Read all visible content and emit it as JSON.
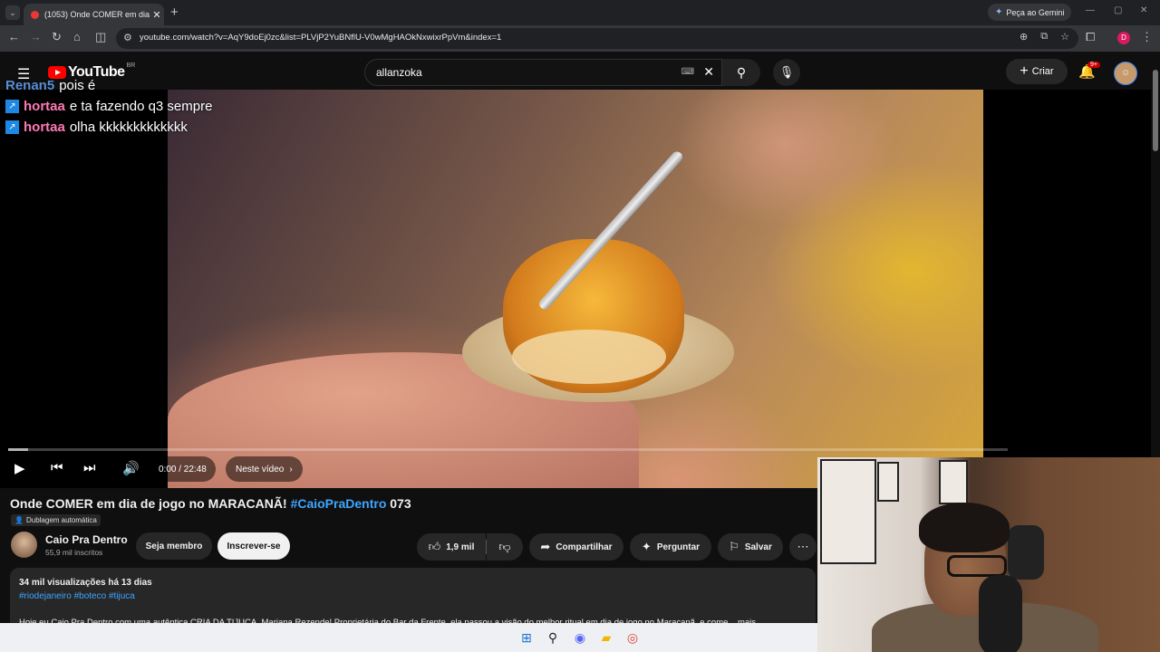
{
  "browser": {
    "tab_title": "(1053) Onde COMER em dia de",
    "new_tab_icon": "plus-icon",
    "gemini_label": "Peça ao Gemini",
    "url": "youtube.com/watch?v=AqY9doEj0zc&list=PLVjP2YuBNflU-V0wMgHAOkNxwixrPpVm&index=1",
    "profile_initial": "D"
  },
  "yt": {
    "logo_text": "YouTube",
    "country": "BR",
    "search_value": "allanzoka",
    "create_label": "Criar",
    "notif_count": "9+"
  },
  "chat": [
    {
      "user": "Renan5",
      "message": "pois é",
      "badge": false
    },
    {
      "user": "hortaa",
      "message": "e ta fazendo q3 sempre",
      "badge": true
    },
    {
      "user": "hortaa",
      "message": "olha kkkkkkkkkkkkk",
      "badge": true
    }
  ],
  "player": {
    "time": "0:00 / 22:48",
    "chapters_label": "Neste vídeo",
    "progress_fraction": 0.02
  },
  "video": {
    "title_main": "Onde COMER em dia de jogo no MARACANÃ! ",
    "title_tag": "#CaioPraDentro",
    "title_end": " 073",
    "dub_label": "Dublagem automática",
    "channel_name": "Caio Pra Dentro",
    "channel_subs": "55,9 mil inscritos",
    "member_label": "Seja membro",
    "subscribe_label": "Inscrever-se",
    "likes": "1,9 mil",
    "share_label": "Compartilhar",
    "ask_label": "Perguntar",
    "save_label": "Salvar"
  },
  "description": {
    "meta": "34 mil visualizações  há 13 dias",
    "tags": "#riodejaneiro #boteco #tijuca",
    "body": "Hoje eu Caio Pra Dentro com uma autêntica CRIA DA TIJUCA, Mariana Rezende! Proprietária do Bar da Frente, ela passou a visão do melhor ritual em dia de jogo no Maracanã, e come...  mais"
  }
}
